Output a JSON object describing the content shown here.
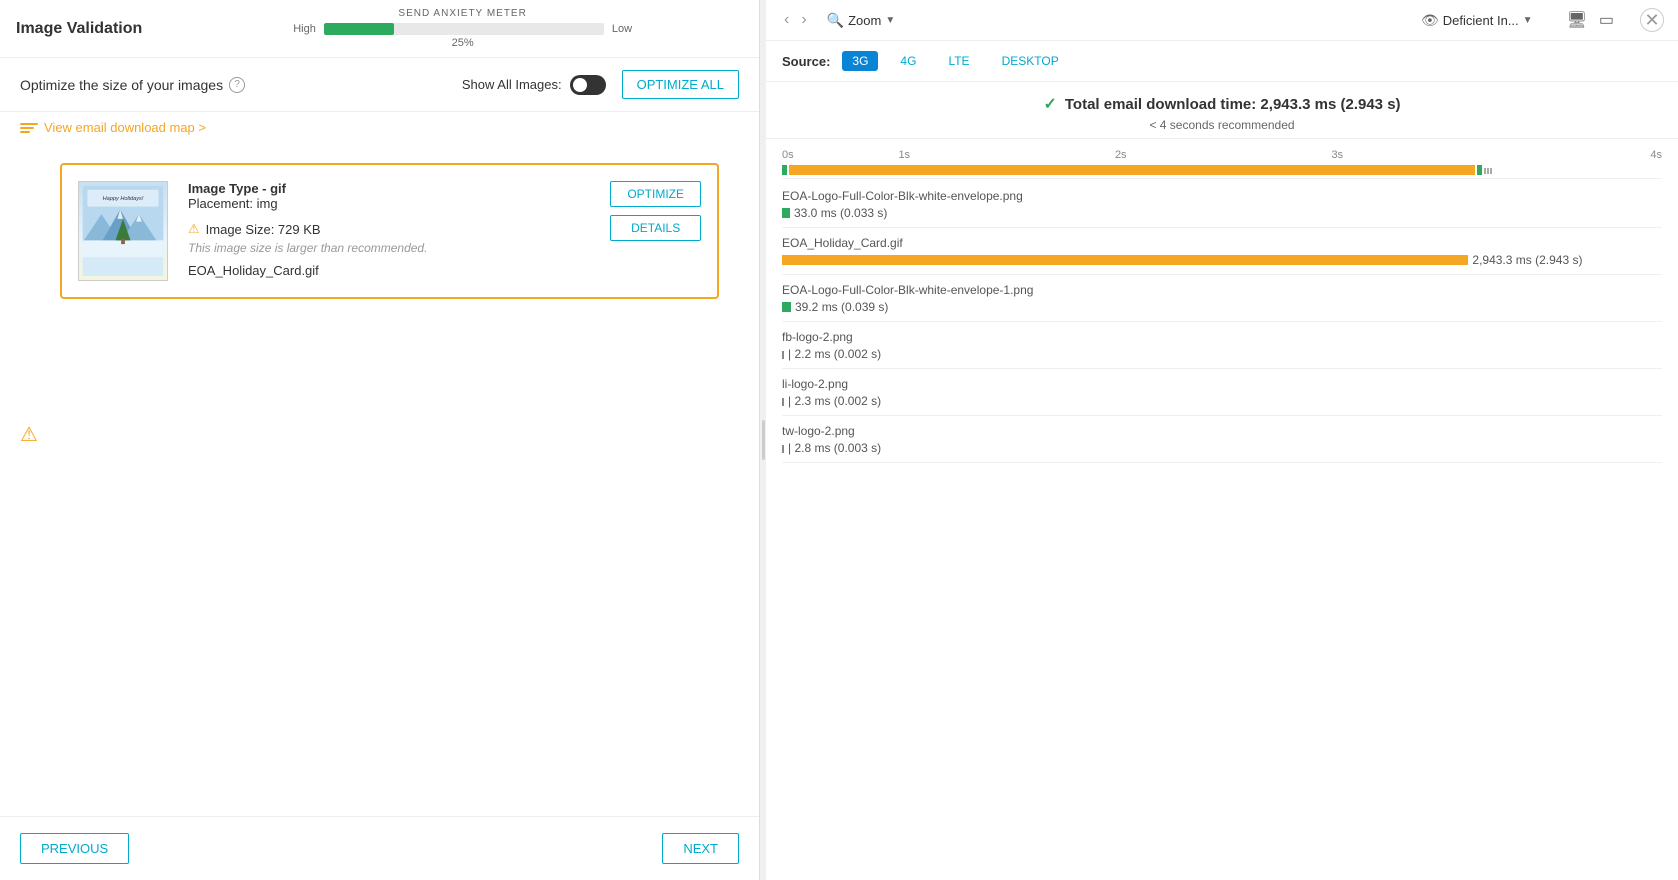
{
  "app": {
    "title": "Image Validation"
  },
  "anxiety_meter": {
    "label": "SEND ANXIETY METER",
    "high_label": "High",
    "low_label": "Low",
    "percentage": "25%",
    "fill_width": "25%"
  },
  "toolbar": {
    "optimize_label": "Optimize the size of your images",
    "show_all_label": "Show All Images:",
    "optimize_all_btn": "OPTIMIZE ALL"
  },
  "download_map": {
    "link_text": "View email download map >"
  },
  "image_card": {
    "type_label": "Image Type - gif",
    "placement_label": "Placement: img",
    "size_label": "Image Size: 729 KB",
    "size_warning": "This image size is larger than recommended.",
    "filename": "EOA_Holiday_Card.gif",
    "optimize_btn": "OPTIMIZE",
    "details_btn": "DETAILS"
  },
  "footer": {
    "previous_btn": "PREVIOUS",
    "next_btn": "NEXT"
  },
  "right_header": {
    "zoom_label": "Zoom",
    "deficient_label": "Deficient In..."
  },
  "source_bar": {
    "source_label": "Source:",
    "sources": [
      "3G",
      "4G",
      "LTE",
      "DESKTOP"
    ],
    "active_source": "3G"
  },
  "download_summary": {
    "title": "Total email download time: 2,943.3 ms (2.943 s)",
    "subtitle": "< 4 seconds recommended"
  },
  "chart": {
    "axis_labels": [
      "0s",
      "1s",
      "2s",
      "3s",
      "4s"
    ],
    "files": [
      {
        "name": "EOA-Logo-Full-Color-Blk-white-envelope.png",
        "time": "33.0 ms (0.033 s)",
        "bar_type": "green",
        "bar_width_pct": 1.1
      },
      {
        "name": "EOA_Holiday_Card.gif",
        "time": "2,943.3 ms (2.943 s)",
        "bar_type": "orange",
        "bar_width_pct": 98
      },
      {
        "name": "EOA-Logo-Full-Color-Blk-white-envelope-1.png",
        "time": "39.2 ms (0.039 s)",
        "bar_type": "green",
        "bar_width_pct": 1.3
      },
      {
        "name": "fb-logo-2.png",
        "time": "| 2.2 ms (0.002 s)",
        "bar_type": "tiny",
        "bar_width_pct": 0
      },
      {
        "name": "li-logo-2.png",
        "time": "| 2.3 ms (0.002 s)",
        "bar_type": "tiny",
        "bar_width_pct": 0
      },
      {
        "name": "tw-logo-2.png",
        "time": "| 2.8 ms (0.003 s)",
        "bar_type": "tiny",
        "bar_width_pct": 0
      }
    ]
  }
}
